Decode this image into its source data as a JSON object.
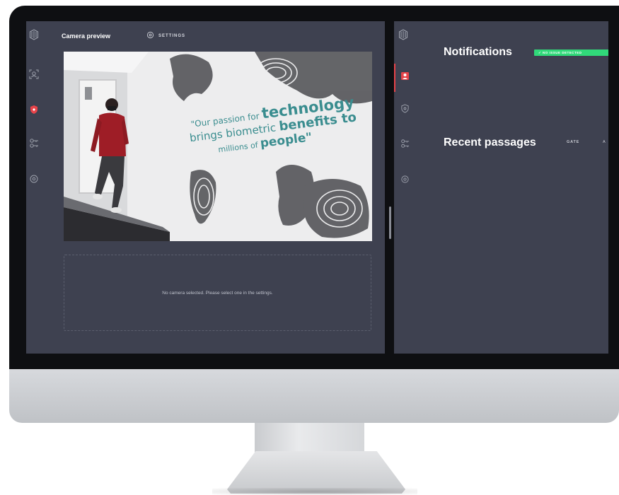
{
  "left_panel": {
    "header_title": "Camera preview",
    "settings_label": "SETTINGS",
    "sidebar_icons": [
      "logo-icon",
      "face-scan-icon",
      "shield-icon",
      "key-icon",
      "gear-icon"
    ],
    "camera_quote": {
      "line1_prefix": "\"Our passion for",
      "line1_emphasis": "technology",
      "line2_prefix": "brings biometric",
      "line2_emphasis": "benefits to",
      "line3_prefix": "millions of",
      "line3_emphasis": "people\""
    },
    "empty_camera_message": "No camera selected. Please select one in the settings."
  },
  "right_panel": {
    "sidebar_icons": [
      "logo-icon",
      "person-badge-icon",
      "shield-icon",
      "key-icon",
      "gear-icon"
    ],
    "notifications_title": "Notifications",
    "issue_badge": "✓ NO ISSUE DETECTED",
    "recent_passages_title": "Recent passages",
    "gate_label": "GATE",
    "gate_extra": "A"
  },
  "colors": {
    "panel_bg": "#3e4150",
    "accent_red": "#e8444a",
    "badge_green": "#31d97a",
    "quote_teal": "#3a8d8f"
  }
}
